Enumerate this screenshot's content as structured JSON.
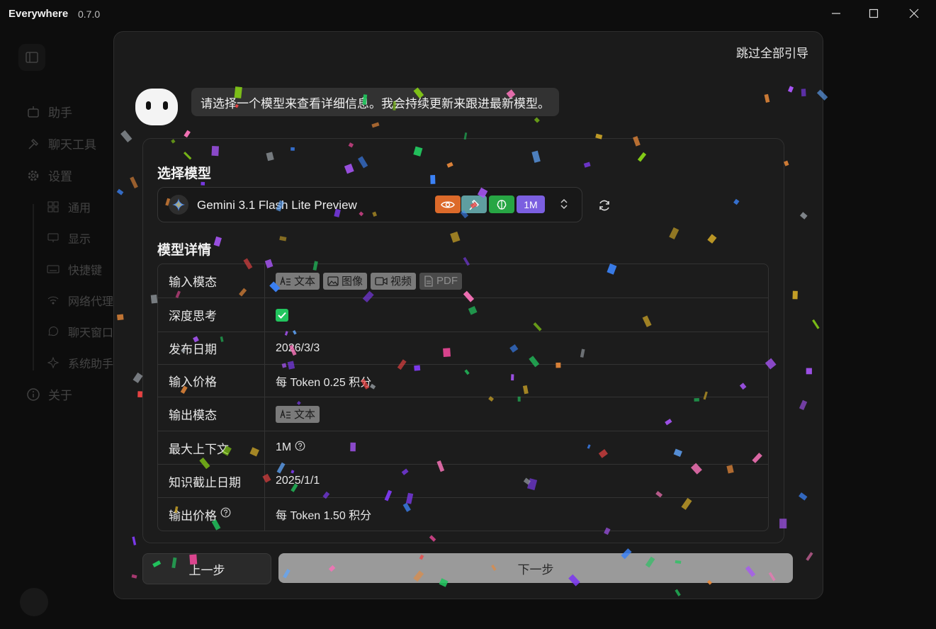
{
  "app": {
    "title": "Everywhere",
    "version": "0.7.0"
  },
  "sidebar": {
    "items": [
      {
        "label": "助手",
        "icon": "robot-icon"
      },
      {
        "label": "聊天工具",
        "icon": "hammer-icon"
      },
      {
        "label": "设置",
        "icon": "gear-icon"
      },
      {
        "label": "通用",
        "icon": "grid-icon"
      },
      {
        "label": "显示",
        "icon": "monitor-icon"
      },
      {
        "label": "快捷键",
        "icon": "keyboard-icon"
      },
      {
        "label": "网络代理",
        "icon": "network-icon"
      },
      {
        "label": "聊天窗口",
        "icon": "chat-icon"
      },
      {
        "label": "系统助手",
        "icon": "sparkle-icon"
      },
      {
        "label": "关于",
        "icon": "info-icon"
      }
    ]
  },
  "dialog": {
    "skip_label": "跳过全部引导",
    "bubble_text": "请选择一个模型来查看详细信息。我会持续更新来跟进最新模型。",
    "select_title": "选择模型",
    "model_name": "Gemini 3.1 Flash Lite Preview",
    "context_badge": "1M",
    "details_title": "模型详情",
    "details": {
      "input_modal_label": "输入模态",
      "input_modal_chips": [
        "文本",
        "图像",
        "视频",
        "PDF"
      ],
      "deep_think_label": "深度思考",
      "deep_think_enabled": true,
      "release_label": "发布日期",
      "release_value": "2026/3/3",
      "input_price_label": "输入价格",
      "input_price_value": "每 Token 0.25 积分",
      "output_modal_label": "输出模态",
      "output_modal_chip": "文本",
      "max_context_label": "最大上下文",
      "max_context_value": "1M",
      "cutoff_label": "知识截止日期",
      "cutoff_value": "2025/1/1",
      "output_price_label": "输出价格",
      "output_price_value": "每 Token 1.50 积分"
    },
    "prev_label": "上一步",
    "next_label": "下一步"
  },
  "colors": {
    "vision_badge": "#dc6a2a",
    "tool_badge": "#5f9ea0",
    "reasoning_badge": "#27a644",
    "context_badge": "#7b5fe0",
    "check": "#22c55e"
  }
}
